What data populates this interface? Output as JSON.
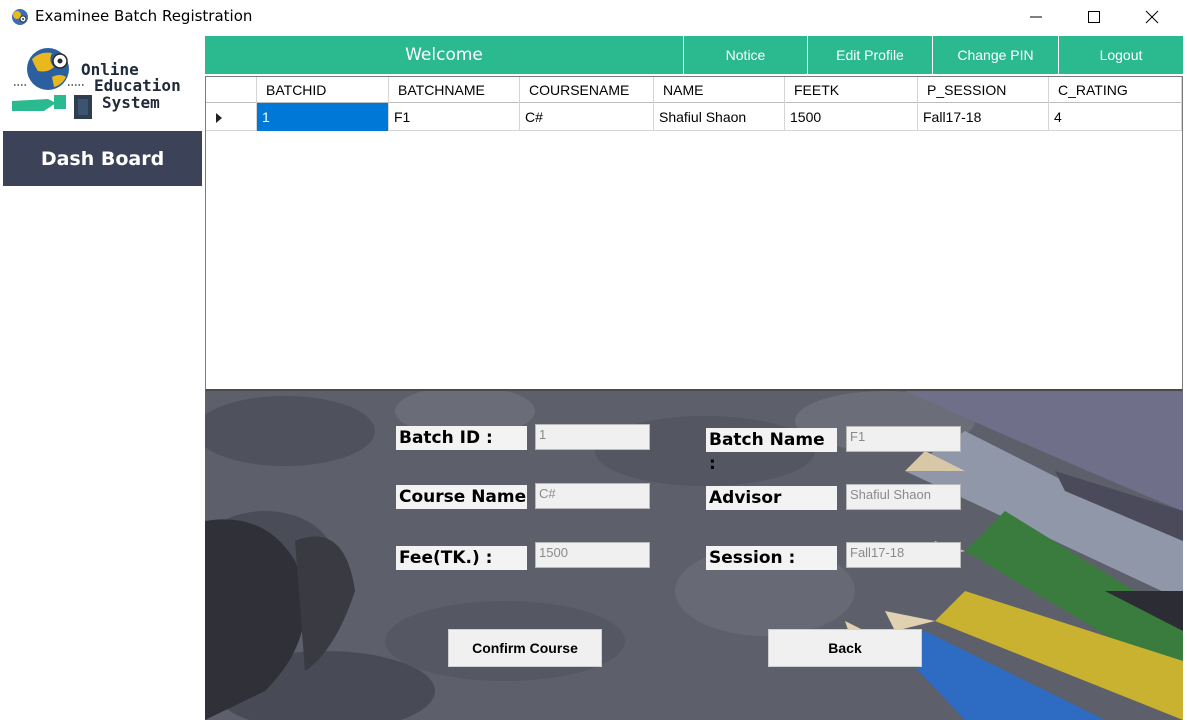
{
  "window": {
    "title": "Examinee Batch Registration"
  },
  "sidebar": {
    "logo": {
      "line1": "Online",
      "line2": "Education",
      "line3": "System"
    },
    "dashboard_label": "Dash Board"
  },
  "topnav": {
    "welcome": "Welcome",
    "notice": "Notice",
    "edit_profile": "Edit Profile",
    "change_pin": "Change PIN",
    "logout": "Logout"
  },
  "grid": {
    "columns": [
      "BATCHID",
      "BATCHNAME",
      "COURSENAME",
      "NAME",
      "FEETK",
      "P_SESSION",
      "C_RATING"
    ],
    "rows": [
      [
        "1",
        "F1",
        "C#",
        "Shafiul Shaon",
        "1500",
        "Fall17-18",
        "4"
      ]
    ]
  },
  "form": {
    "batch_id_label": "Batch ID :",
    "batch_id_value": "1",
    "batch_name_label": "Batch Name :",
    "batch_name_value": "F1",
    "course_name_label": "Course Name",
    "course_name_value": "C#",
    "advisor_label": "Advisor",
    "advisor_value": "Shafiul Shaon",
    "fee_label": "Fee(TK.)  :",
    "fee_value": "1500",
    "session_label": "Session :",
    "session_value": "Fall17-18",
    "confirm_label": "Confirm Course",
    "back_label": "Back"
  },
  "colors": {
    "accent": "#2bb98f",
    "sidebar_button": "#3c4358",
    "selection": "#0078d7",
    "panel": "#5a5c68"
  }
}
